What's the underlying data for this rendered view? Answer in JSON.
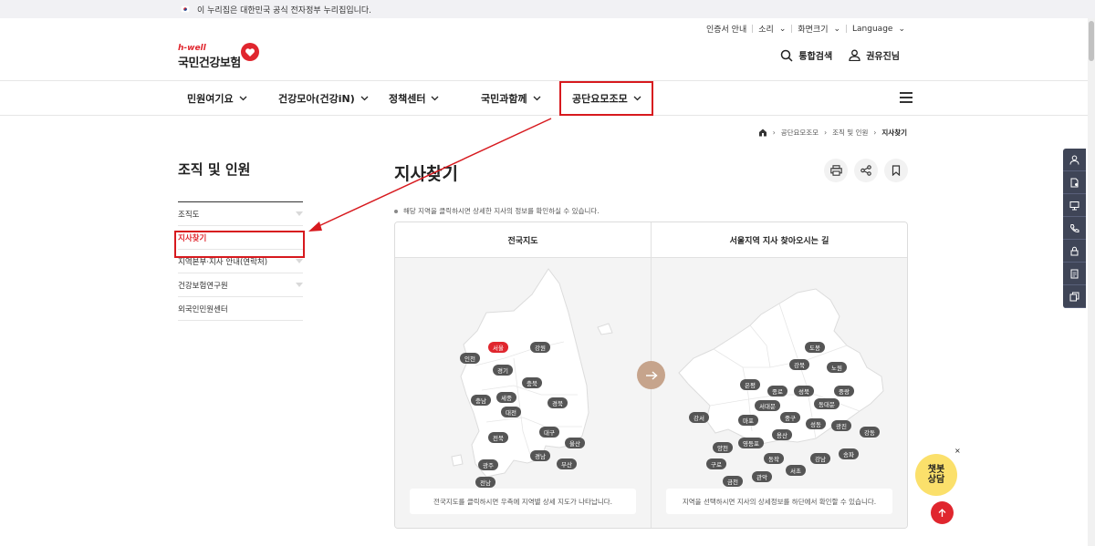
{
  "gov_banner": {
    "text": "이 누리집은 대한민국 공식 전자정부 누리집입니다."
  },
  "util_links": [
    "인증서 안내",
    "소리",
    "화면크기",
    "Language"
  ],
  "logo": {
    "sub": "h-well",
    "main": "국민건강보험"
  },
  "header_actions": {
    "search": "통합검색",
    "user": "권유진님"
  },
  "gnb": [
    "민원여기요",
    "건강모아(건강iN)",
    "정책센터",
    "국민과함께",
    "공단요모조모"
  ],
  "breadcrumb": [
    "공단요모조모",
    "조직 및 인원",
    "지사찾기"
  ],
  "lnb": {
    "title": "조직 및 인원",
    "items": [
      "조직도",
      "지사찾기",
      "지역본부·지사 안내(연락처)",
      "건강보험연구원",
      "외국인민원센터"
    ]
  },
  "page": {
    "title": "지사찾기",
    "notice": "해당 지역을 클릭하시면 상세한 지사의 정보를 확인하실 수 있습니다."
  },
  "map_left": {
    "heading": "전국지도",
    "note": "전국지도를 클릭하시면 우측에 지역별 상세 지도가 나타납니다.",
    "regions": [
      "서울",
      "강원",
      "인천",
      "경기",
      "충북",
      "충남",
      "세종",
      "대전",
      "경북",
      "전북",
      "대구",
      "울산",
      "경남",
      "부산",
      "광주",
      "전남",
      "제주"
    ],
    "selected": "서울"
  },
  "map_right": {
    "heading": "서울지역 지사 찾아오시는 길",
    "note": "지역을 선택하시면 지사의 상세정보를 하단에서 확인할 수 있습니다.",
    "districts": [
      "도봉",
      "강북",
      "노원",
      "은평",
      "종로",
      "성북",
      "중랑",
      "서대문",
      "동대문",
      "강서",
      "마포",
      "중구",
      "성동",
      "광진",
      "강동",
      "용산",
      "양천",
      "영등포",
      "구로",
      "동작",
      "강남",
      "송파",
      "서초",
      "금천",
      "관악"
    ]
  },
  "chatbot": {
    "line1": "챗봇",
    "line2": "상담",
    "close": "×"
  },
  "colors": {
    "accent": "#e0262e",
    "highlight": "#d7191e",
    "pin": "#555555",
    "sidebar": "#3f4557",
    "chatbot": "#fbe06b"
  },
  "icons": {
    "sidebar": [
      "person-icon",
      "document-icon",
      "monitor-icon",
      "phone-icon",
      "lock-icon",
      "doc-list-icon",
      "copy-icon"
    ]
  }
}
